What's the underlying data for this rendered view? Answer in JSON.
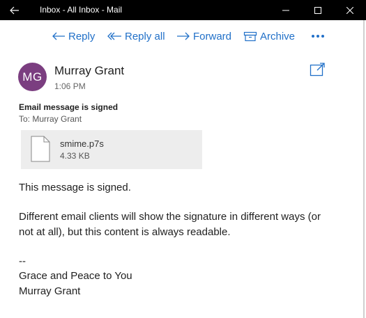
{
  "window": {
    "title": "Inbox - All Inbox - Mail"
  },
  "toolbar": {
    "reply_label": "Reply",
    "reply_all_label": "Reply all",
    "forward_label": "Forward",
    "archive_label": "Archive",
    "more_icon": "more-icon",
    "accent_color": "#2170c8"
  },
  "message": {
    "avatar_initials": "MG",
    "avatar_color": "#7b3e80",
    "sender": "Murray Grant",
    "time": "1:06 PM",
    "subject": "Email message is signed",
    "to": "To: Murray Grant",
    "attachment": {
      "name": "smime.p7s",
      "size": "4.33 KB"
    },
    "body": {
      "line1": "This message is signed.",
      "line2a": "Different email clients will show the signature in different ways (or",
      "line2b": "not at all), but this content is always readable.",
      "sig_sep": "--",
      "sig_line1": "Grace and Peace to You",
      "sig_line2": "Murray Grant"
    }
  }
}
